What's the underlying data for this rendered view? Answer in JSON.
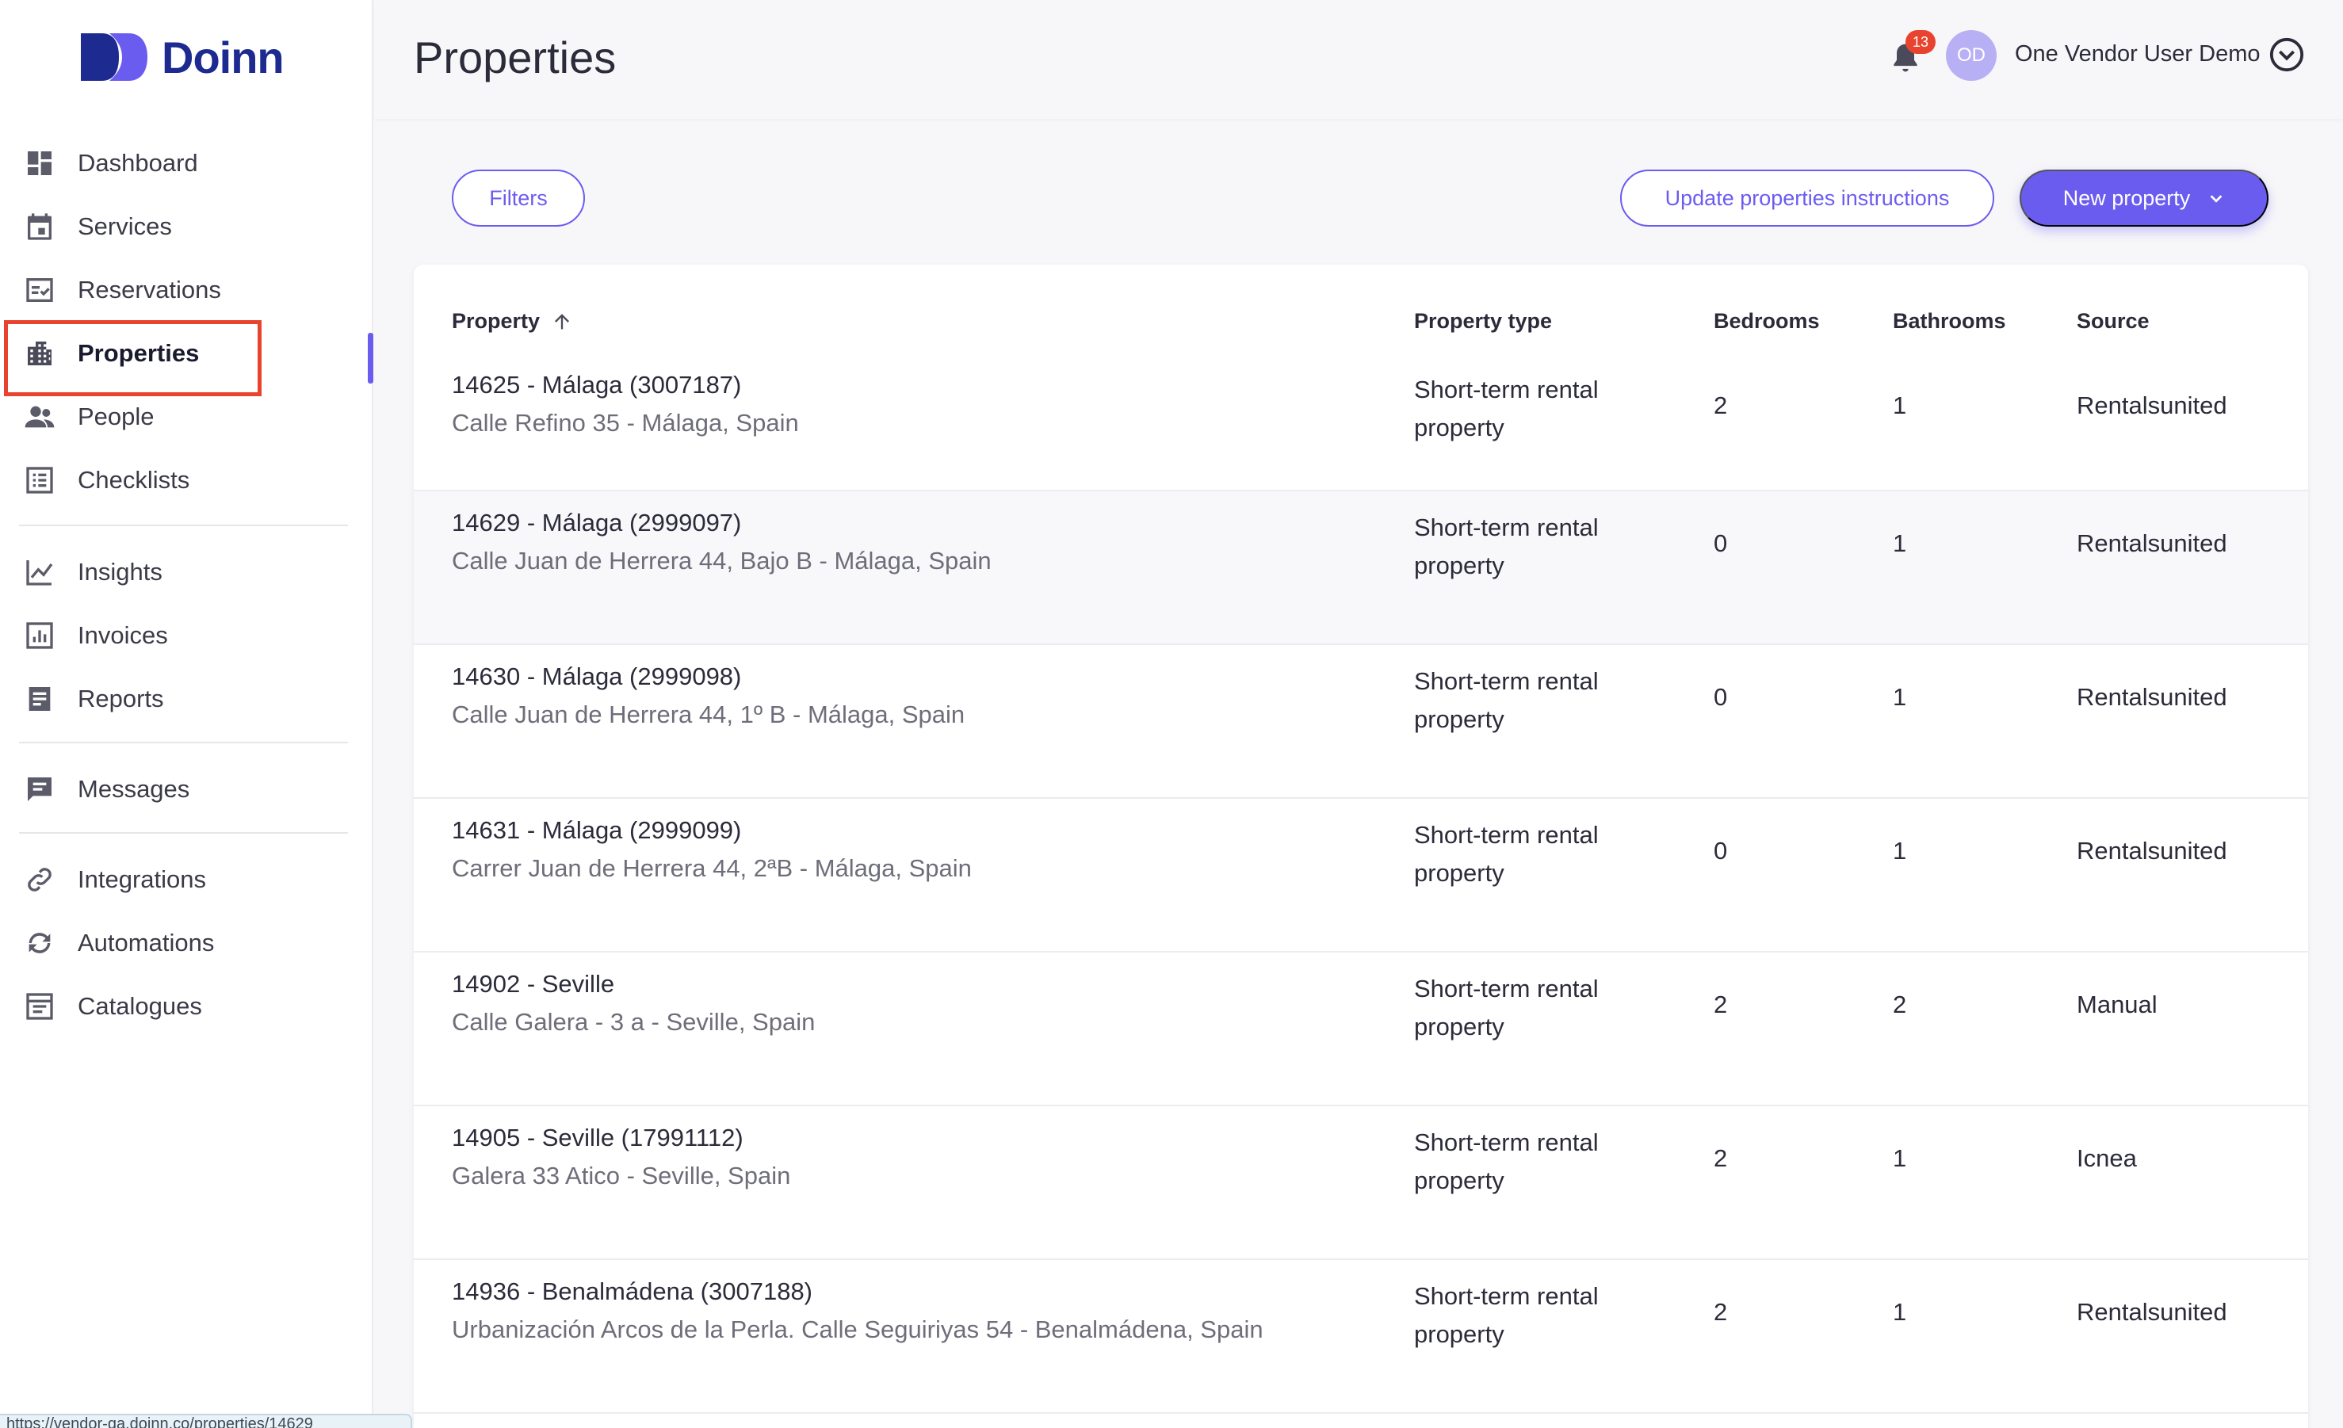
{
  "brand": {
    "name": "Doinn",
    "color": "#1d2a8f"
  },
  "accent": "#6b5cf0",
  "sidebar": {
    "items": [
      {
        "label": "Dashboard",
        "icon": "dashboard-icon"
      },
      {
        "label": "Services",
        "icon": "calendar-icon"
      },
      {
        "label": "Reservations",
        "icon": "calendar-check-icon"
      },
      {
        "label": "Properties",
        "icon": "building-icon",
        "active": true
      },
      {
        "label": "People",
        "icon": "people-icon"
      },
      {
        "label": "Checklists",
        "icon": "checklist-icon"
      },
      {
        "label": "Insights",
        "icon": "line-chart-icon"
      },
      {
        "label": "Invoices",
        "icon": "bar-chart-icon"
      },
      {
        "label": "Reports",
        "icon": "report-icon"
      },
      {
        "label": "Messages",
        "icon": "message-icon"
      },
      {
        "label": "Integrations",
        "icon": "link-icon"
      },
      {
        "label": "Automations",
        "icon": "sync-icon"
      },
      {
        "label": "Catalogues",
        "icon": "catalogue-icon"
      }
    ]
  },
  "status_url": "https://vendor-qa.doinn.co/properties/14629",
  "header": {
    "title": "Properties",
    "notification_count": "13",
    "avatar_initials": "OD",
    "user_name": "One Vendor User Demo"
  },
  "toolbar": {
    "filters_label": "Filters",
    "update_label": "Update properties instructions",
    "new_label": "New property"
  },
  "table": {
    "columns": {
      "property": "Property",
      "type": "Property type",
      "bedrooms": "Bedrooms",
      "bathrooms": "Bathrooms",
      "source": "Source"
    },
    "rows": [
      {
        "name": "14625 - Málaga (3007187)",
        "address": "Calle Refino 35 - Málaga, Spain",
        "type": "Short-term rental property",
        "bedrooms": "2",
        "bathrooms": "1",
        "source": "Rentalsunited"
      },
      {
        "name": "14629 - Málaga (2999097)",
        "address": "Calle Juan de Herrera 44, Bajo B - Málaga, Spain",
        "type": "Short-term rental property",
        "bedrooms": "0",
        "bathrooms": "1",
        "source": "Rentalsunited"
      },
      {
        "name": "14630 - Málaga (2999098)",
        "address": "Calle Juan de Herrera 44, 1º B - Málaga, Spain",
        "type": "Short-term rental property",
        "bedrooms": "0",
        "bathrooms": "1",
        "source": "Rentalsunited"
      },
      {
        "name": "14631 - Málaga (2999099)",
        "address": "Carrer Juan de Herrera 44, 2ªB - Málaga, Spain",
        "type": "Short-term rental property",
        "bedrooms": "0",
        "bathrooms": "1",
        "source": "Rentalsunited"
      },
      {
        "name": "14902 - Seville",
        "address": "Calle Galera - 3 a - Seville, Spain",
        "type": "Short-term rental property",
        "bedrooms": "2",
        "bathrooms": "2",
        "source": "Manual"
      },
      {
        "name": "14905 - Seville (17991112)",
        "address": "Galera 33 Atico - Seville, Spain",
        "type": "Short-term rental property",
        "bedrooms": "2",
        "bathrooms": "1",
        "source": "Icnea"
      },
      {
        "name": "14936 - Benalmádena (3007188)",
        "address": "Urbanización Arcos de la Perla. Calle Seguiriyas 54 - Benalmádena, Spain",
        "type": "Short-term rental property",
        "bedrooms": "2",
        "bathrooms": "1",
        "source": "Rentalsunited"
      }
    ]
  }
}
